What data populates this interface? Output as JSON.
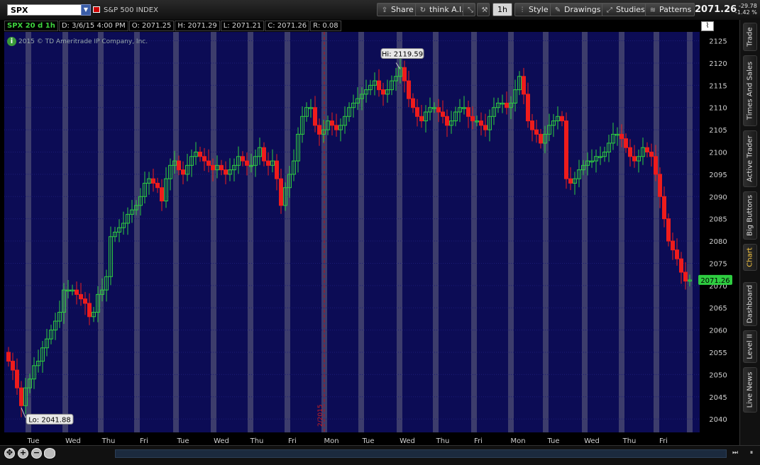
{
  "toolbar": {
    "symbol": "SPX",
    "description": "S&P 500 INDEX",
    "share_label": "Share",
    "think_label": "think A.I.",
    "timeframe_label": "1h",
    "style_label": "Style",
    "drawings_label": "Drawings",
    "studies_label": "Studies",
    "patterns_label": "Patterns",
    "last_price": "2071.26",
    "change": "-29.78",
    "change_pct": "-1.42 %"
  },
  "info_bar": {
    "symbol": "SPX 20 d 1h",
    "date": "D: 3/6/15 4:00 PM",
    "open": "O: 2071.25",
    "high": "H: 2071.29",
    "low": "L: 2071.21",
    "close": "C: 2071.26",
    "range": "R: 0.08"
  },
  "copyright": "2015 © TD Ameritrade IP Company, Inc.",
  "sidebar_tabs": [
    "Trade",
    "Times And Sales",
    "Active Trader",
    "Big Buttons",
    "Chart",
    "Dashboard",
    "Level II",
    "Live News"
  ],
  "colors": {
    "background": "#0c0c55",
    "up": "#2ecc40",
    "down": "#ee1c1c",
    "session_band": "#3d3d6c",
    "current_price_box": "#2ecc40"
  },
  "chart_data": {
    "type": "candlestick",
    "title": "SPX 20 d 1h",
    "ylim": [
      2037,
      2127
    ],
    "yticks": [
      2040,
      2045,
      2050,
      2055,
      2060,
      2065,
      2070,
      2075,
      2080,
      2085,
      2090,
      2095,
      2100,
      2105,
      2110,
      2115,
      2120,
      2125
    ],
    "day_labels": [
      "Tue",
      "Wed",
      "Thu",
      "Fri",
      "Tue",
      "Wed",
      "Thu",
      "Fri",
      "Mon",
      "Tue",
      "Wed",
      "Thu",
      "Fri",
      "Mon",
      "Tue",
      "Wed",
      "Thu",
      "Fri"
    ],
    "new_month_marker": "2/2015",
    "hi_label": "Hi: 2119.59",
    "lo_label": "Lo: 2041.88",
    "current_price_label": "2071.26",
    "close_series": [
      2053,
      2051,
      2047,
      2043,
      2047,
      2049,
      2052,
      2053,
      2056,
      2058,
      2060,
      2062,
      2064,
      2069,
      2069,
      2069,
      2068,
      2067,
      2066,
      2063,
      2064,
      2068,
      2069,
      2072,
      2081,
      2082,
      2083,
      2084,
      2086,
      2087,
      2088,
      2090,
      2093,
      2094,
      2093,
      2092,
      2089,
      2094,
      2097,
      2098,
      2096,
      2095,
      2097,
      2099,
      2100,
      2099,
      2098,
      2097,
      2096,
      2097,
      2096,
      2095,
      2096,
      2097,
      2099,
      2098,
      2097,
      2097,
      2099,
      2101,
      2098,
      2097,
      2098,
      2094,
      2088,
      2092,
      2095,
      2098,
      2104,
      2108,
      2110,
      2110,
      2106,
      2104,
      2105,
      2107,
      2106,
      2105,
      2106,
      2108,
      2110,
      2111,
      2112,
      2113,
      2114,
      2115,
      2116,
      2114,
      2113,
      2114,
      2116,
      2117,
      2119,
      2116,
      2112,
      2110,
      2108,
      2107,
      2109,
      2110,
      2110,
      2109,
      2108,
      2106,
      2107,
      2109,
      2110,
      2110,
      2108,
      2107,
      2107,
      2106,
      2105,
      2108,
      2110,
      2111,
      2111,
      2110,
      2111,
      2114,
      2117,
      2113,
      2107,
      2105,
      2104,
      2102,
      2104,
      2106,
      2107,
      2108,
      2107,
      2094,
      2093,
      2094,
      2096,
      2097,
      2098,
      2098,
      2099,
      2099,
      2100,
      2102,
      2104,
      2104,
      2103,
      2101,
      2099,
      2098,
      2099,
      2101,
      2100,
      2099,
      2095,
      2090,
      2085,
      2080,
      2078,
      2076,
      2073,
      2071,
      2071.26
    ]
  }
}
